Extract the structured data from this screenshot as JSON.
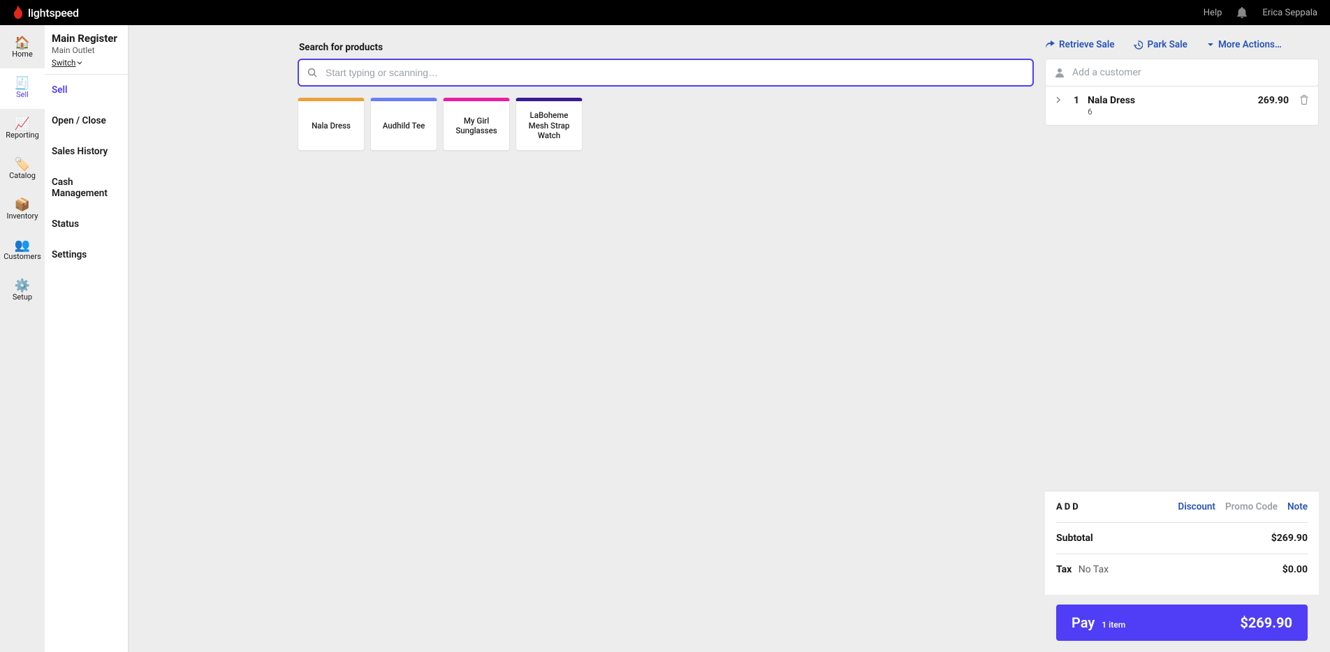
{
  "brand": {
    "name": "lightspeed",
    "flame_color": "#e0281a"
  },
  "topbar": {
    "help": "Help",
    "user_name": "Erica Seppala"
  },
  "rail": [
    {
      "id": "home",
      "label": "Home",
      "glyph": "🏠"
    },
    {
      "id": "sell",
      "label": "Sell",
      "glyph": "🧾",
      "active": true
    },
    {
      "id": "reporting",
      "label": "Reporting",
      "glyph": "📈"
    },
    {
      "id": "catalog",
      "label": "Catalog",
      "glyph": "🏷️"
    },
    {
      "id": "inventory",
      "label": "Inventory",
      "glyph": "📦"
    },
    {
      "id": "customers",
      "label": "Customers",
      "glyph": "👥"
    },
    {
      "id": "setup",
      "label": "Setup",
      "glyph": "⚙️"
    }
  ],
  "subnav": {
    "title": "Main Register",
    "subtitle": "Main Outlet",
    "switch": "Switch",
    "items": [
      {
        "id": "sell",
        "label": "Sell",
        "active": true
      },
      {
        "id": "openclose",
        "label": "Open / Close"
      },
      {
        "id": "saleshistory",
        "label": "Sales History"
      },
      {
        "id": "cashmgmt",
        "label": "Cash Management"
      },
      {
        "id": "status",
        "label": "Status"
      },
      {
        "id": "settings",
        "label": "Settings"
      }
    ]
  },
  "search": {
    "label": "Search for products",
    "placeholder": "Start typing or scanning…"
  },
  "quick_products": [
    {
      "name": "Nala Dress",
      "color": "#e8a13a"
    },
    {
      "name": "Audhild Tee",
      "color": "#6a7ef0"
    },
    {
      "name": "My Girl Sunglasses",
      "color": "#e81fa4"
    },
    {
      "name": "LaBoheme Mesh Strap Watch",
      "color": "#3a1b8f"
    }
  ],
  "top_actions": {
    "retrieve": "Retrieve Sale",
    "park": "Park Sale",
    "more": "More Actions…"
  },
  "customer": {
    "placeholder": "Add a customer"
  },
  "cart": {
    "items": [
      {
        "qty": "1",
        "name": "Nala Dress",
        "variant": "6",
        "price": "269.90"
      }
    ]
  },
  "totals": {
    "add_label": "ADD",
    "discount": "Discount",
    "promo": "Promo Code",
    "note": "Note",
    "subtotal_label": "Subtotal",
    "subtotal_value": "$269.90",
    "tax_label": "Tax",
    "tax_name": "No Tax",
    "tax_value": "$0.00"
  },
  "pay": {
    "label": "Pay",
    "count": "1 item",
    "amount": "$269.90"
  }
}
